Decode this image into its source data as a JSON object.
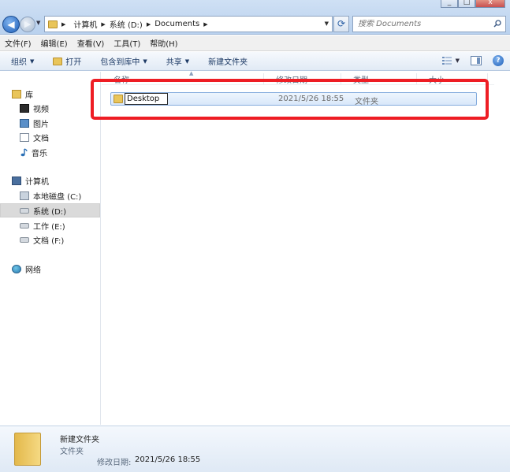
{
  "window": {
    "controls": {
      "minimize": "_",
      "maximize": "□",
      "close": "x"
    }
  },
  "address": {
    "crumbs": [
      "计算机",
      "系统 (D:)",
      "Documents"
    ]
  },
  "search": {
    "placeholder": "搜索 Documents"
  },
  "menu": {
    "items": [
      "文件(F)",
      "编辑(E)",
      "查看(V)",
      "工具(T)",
      "帮助(H)"
    ]
  },
  "toolbar": {
    "organize": "组织",
    "open": "打开",
    "include_in_library": "包含到库中",
    "share": "共享",
    "new_folder": "新建文件夹",
    "help": "?"
  },
  "nav": {
    "libraries": "库",
    "videos": "视频",
    "pictures": "图片",
    "documents": "文档",
    "music": "音乐",
    "computer": "计算机",
    "drive_c": "本地磁盘 (C:)",
    "drive_d": "系统 (D:)",
    "drive_e": "工作 (E:)",
    "drive_f": "文档 (F:)",
    "network": "网络"
  },
  "columns": {
    "name": "名称",
    "modified": "修改日期",
    "type": "类型",
    "size": "大小"
  },
  "files": [
    {
      "name": "Desktop",
      "modified": "2021/5/26 18:55",
      "type": "文件夹"
    }
  ],
  "details": {
    "name": "新建文件夹",
    "type": "文件夹",
    "date_label": "修改日期:",
    "date": "2021/5/26 18:55"
  },
  "colors": {
    "highlight": "#ee1d24",
    "accent": "#1f5fb8",
    "folder": "#e9c55a"
  }
}
